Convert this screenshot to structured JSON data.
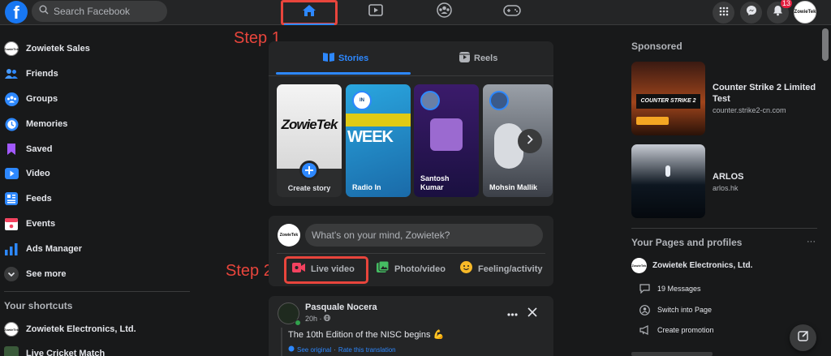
{
  "topbar": {
    "logo": "f",
    "search_placeholder": "Search Facebook",
    "notifications_count": "13",
    "avatar_text": "ZowieTek",
    "icons": [
      "home-icon",
      "watch-icon",
      "groups-icon",
      "gaming-icon",
      "menu-grid-icon",
      "messenger-icon",
      "bell-icon"
    ]
  },
  "annotations": {
    "step1": "Step 1",
    "step2": "Step 2",
    "color": "#e8453c"
  },
  "sidebar": {
    "items": [
      {
        "label": "Zowietek Sales",
        "icon": "profile-avatar"
      },
      {
        "label": "Friends",
        "icon": "friends-icon"
      },
      {
        "label": "Groups",
        "icon": "groups-icon"
      },
      {
        "label": "Memories",
        "icon": "memories-icon"
      },
      {
        "label": "Saved",
        "icon": "saved-icon"
      },
      {
        "label": "Video",
        "icon": "video-icon"
      },
      {
        "label": "Feeds",
        "icon": "feeds-icon"
      },
      {
        "label": "Events",
        "icon": "events-icon"
      },
      {
        "label": "Ads Manager",
        "icon": "ads-manager-icon"
      },
      {
        "label": "See more",
        "icon": "chevron-down-icon"
      }
    ],
    "shortcuts_title": "Your shortcuts",
    "shortcuts": [
      {
        "label": "Zowietek Electronics, Ltd."
      },
      {
        "label": "Live Cricket Match"
      }
    ]
  },
  "stories_card": {
    "tabs": [
      {
        "label": "Stories",
        "active": true
      },
      {
        "label": "Reels",
        "active": false
      }
    ],
    "stories": [
      {
        "name": "Create story",
        "banner": "ZowieTek"
      },
      {
        "name": "Radio In",
        "banner": "WEEK"
      },
      {
        "name": "Santosh Kumar"
      },
      {
        "name": "Mohsin Mallik"
      }
    ]
  },
  "composer": {
    "avatar_text": "ZowieTek",
    "placeholder": "What's on your mind, Zowietek?",
    "actions": [
      {
        "label": "Live video",
        "icon": "live-video-icon",
        "color": "#f3425f"
      },
      {
        "label": "Photo/video",
        "icon": "photo-icon",
        "color": "#45bd62"
      },
      {
        "label": "Feeling/activity",
        "icon": "feeling-icon",
        "color": "#f7b928"
      }
    ]
  },
  "post": {
    "author": "Pasquale Nocera",
    "time": "20h · ",
    "text": "The 10th Edition of the NISC begins 💪",
    "see_original": "See original",
    "separator": " · ",
    "rate_translation": "Rate this translation"
  },
  "right": {
    "sponsored_title": "Sponsored",
    "ads": [
      {
        "name": "Counter Strike 2 Limited Test",
        "url": "counter.strike2-cn.com",
        "banner": "COUNTER STRIKE 2"
      },
      {
        "name": "ARLOS",
        "url": "arlos.hk"
      }
    ],
    "pages_title": "Your Pages and profiles",
    "more": "···",
    "page_name": "Zowietek Electronics, Ltd.",
    "page_avatar_text": "ZowieTek",
    "page_actions": [
      {
        "label": "19 Messages",
        "icon": "messages-icon"
      },
      {
        "label": "Switch into Page",
        "icon": "switch-icon"
      },
      {
        "label": "Create promotion",
        "icon": "megaphone-icon"
      }
    ]
  },
  "colors": {
    "background": "#18191a",
    "surface": "#242526",
    "accent": "#2d88ff",
    "annotation": "#e8453c"
  }
}
